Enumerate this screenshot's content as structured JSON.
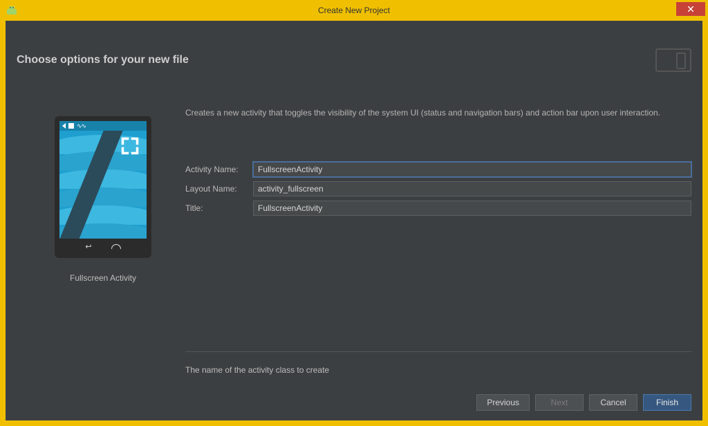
{
  "window": {
    "title": "Create New Project"
  },
  "header": {
    "heading": "Choose options for your new file"
  },
  "preview": {
    "label": "Fullscreen Activity"
  },
  "description": "Creates a new activity that toggles the visibility of the system UI (status and navigation bars) and action bar upon user interaction.",
  "form": {
    "activity_name": {
      "label": "Activity Name:",
      "value": "FullscreenActivity"
    },
    "layout_name": {
      "label": "Layout Name:",
      "value": "activity_fullscreen"
    },
    "title": {
      "label": "Title:",
      "value": "FullscreenActivity"
    }
  },
  "hint": "The name of the activity class to create",
  "buttons": {
    "previous": "Previous",
    "next": "Next",
    "cancel": "Cancel",
    "finish": "Finish"
  }
}
